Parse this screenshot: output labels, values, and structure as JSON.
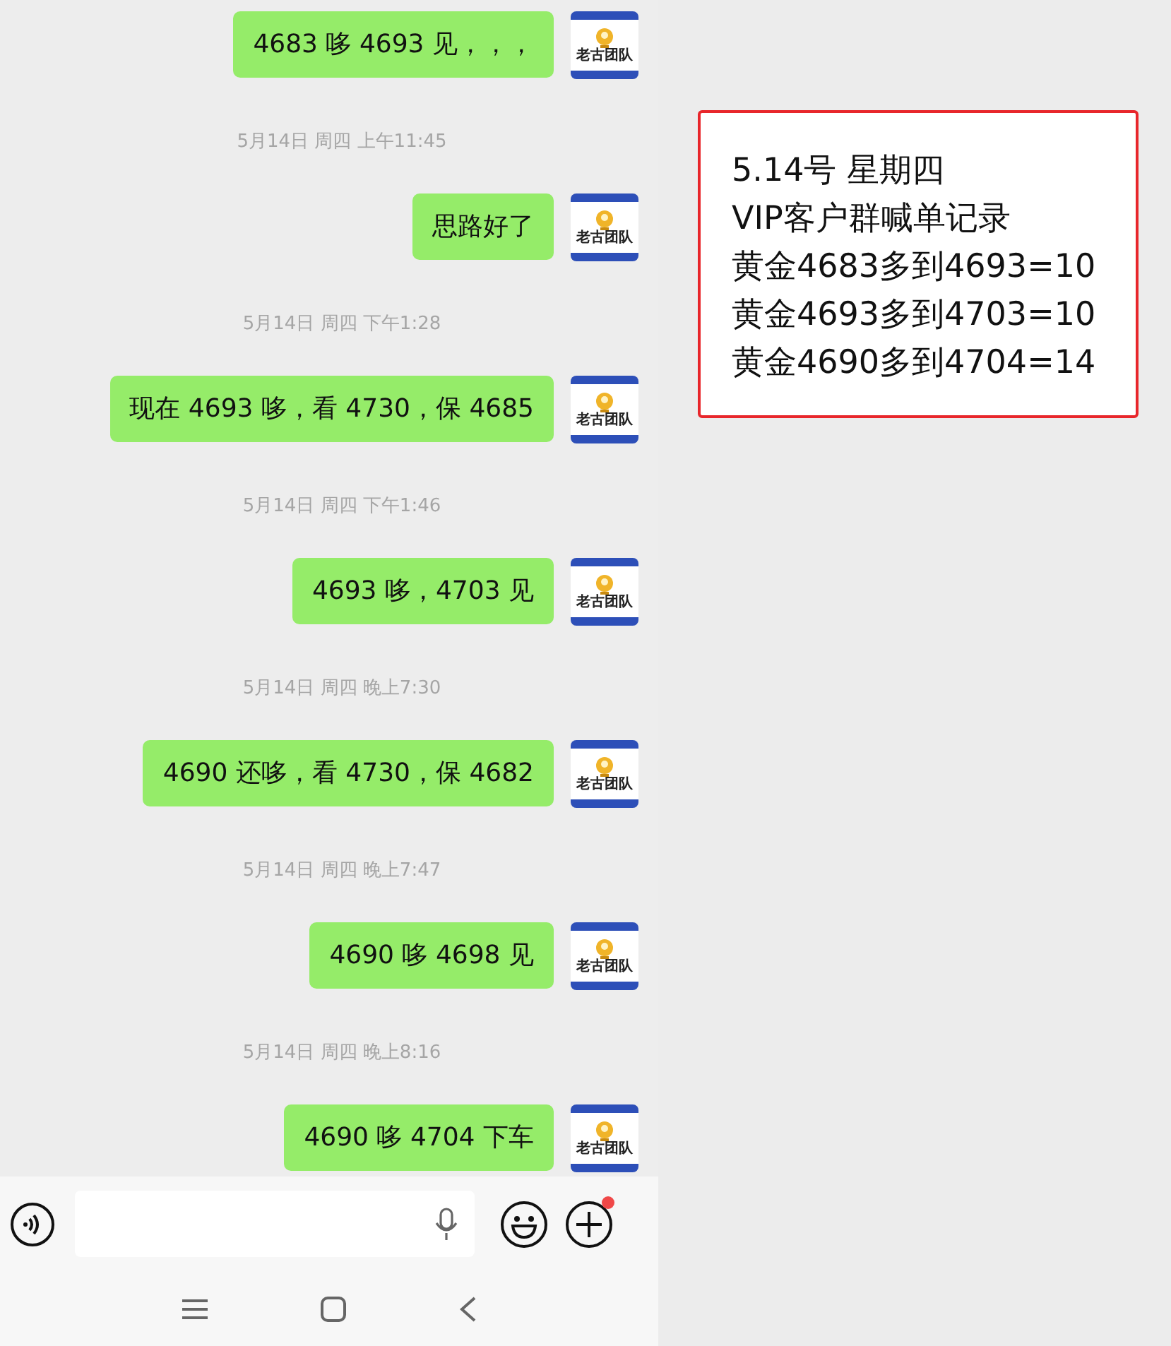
{
  "chat": [
    {
      "kind": "message",
      "text": "4683 哆 4693 见，，，",
      "avatar_label": "老古团队"
    },
    {
      "kind": "time",
      "text": "5月14日 周四 上午11:45"
    },
    {
      "kind": "message",
      "text": "思路好了",
      "avatar_label": "老古团队"
    },
    {
      "kind": "time",
      "text": "5月14日 周四 下午1:28"
    },
    {
      "kind": "message",
      "text": "现在 4693 哆，看 4730，保 4685",
      "avatar_label": "老古团队"
    },
    {
      "kind": "time",
      "text": "5月14日 周四 下午1:46"
    },
    {
      "kind": "message",
      "text": "4693 哆，4703 见",
      "avatar_label": "老古团队"
    },
    {
      "kind": "time",
      "text": "5月14日 周四 晚上7:30"
    },
    {
      "kind": "message",
      "text": "4690 还哆，看 4730，保 4682",
      "avatar_label": "老古团队"
    },
    {
      "kind": "time",
      "text": "5月14日 周四 晚上7:47"
    },
    {
      "kind": "message",
      "text": "4690 哆 4698 见",
      "avatar_label": "老古团队"
    },
    {
      "kind": "time",
      "text": "5月14日 周四 晚上8:16"
    },
    {
      "kind": "message",
      "text": "4690 哆 4704 下车",
      "avatar_label": "老古团队"
    }
  ],
  "input_bar": {
    "plus_notification": true
  },
  "note": {
    "lines": [
      "5.14号  星期四",
      "VIP客户群喊单记录",
      "黄金4683多到4693=10",
      "黄金4693多到4703=10",
      "黄金4690多到4704=14"
    ]
  }
}
